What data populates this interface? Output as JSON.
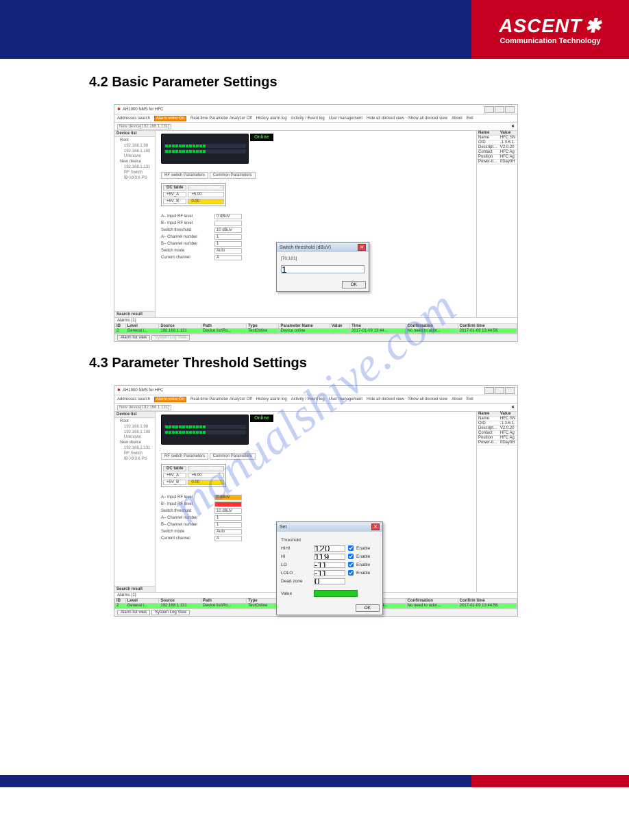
{
  "header": {
    "brand": "ASCENT",
    "brand_sub": "Communication Technology",
    "star": "✱"
  },
  "watermark": "manualshive.com",
  "sections": {
    "s1": {
      "num": "4.2",
      "title": "Basic Parameter Settings"
    },
    "s2": {
      "num": "4.3",
      "title": "Parameter Threshold Settings"
    }
  },
  "app": {
    "window_title": "AH1000 NMS for HFC",
    "toolbar": {
      "addresses_search": "Addresses search",
      "alarm_voice": "Alarm voice On",
      "analyzer": "Real-time Parameter Analyzer Off",
      "history": "History alarm log",
      "activity": "Activity / Event log",
      "user_mgmt": "User management",
      "hide_docked": "Hide all docked view",
      "show_docked": "Show all docked view",
      "about": "About",
      "exit": "Exit"
    },
    "sub_title_label": "New device[192.168.1.131]",
    "close_x": "✕",
    "device_list_title": "Device list",
    "tree": {
      "root": "Root",
      "node1": "192.168.1.98",
      "node2": "192.168.1.100",
      "node3": "Unknown",
      "node4": "New device",
      "node5": "192.168.1.131",
      "node6": "RF Switch",
      "node7": "IB-XXXX-PS"
    },
    "search_result": "Search result",
    "online": "Online",
    "tabs": {
      "rf": "RF switch Parameters",
      "common": "Common Parameters"
    },
    "dc": {
      "col1": "DC table",
      "col2": "Output voltage",
      "r1c1": "+5V_A",
      "r1c2": "+5.00",
      "r2c1": "+5V_B",
      "r2c2": "0.00"
    },
    "params": {
      "p1": "A– Input RF level",
      "p2": "B– Input RF level",
      "p3": "Switch threshold",
      "p4": "A– Channel number",
      "p5": "B– Channel number",
      "p6": "Switch mode",
      "p7": "Current channel",
      "v1": "0 dBuV",
      "v2": "",
      "v3": "10 dBuV",
      "v4": "1",
      "v5": "1",
      "v6": "Auto",
      "v7": "A"
    },
    "right": {
      "name_h": "Name",
      "value_h": "Value",
      "r1n": "Name",
      "r1v": "HFC SN",
      "r2n": "OID",
      "r2v": ".1.3.6.1.",
      "r3n": "Descript...",
      "r3v": "V2.0.20",
      "r4n": "Contact",
      "r4v": "HFC Ag",
      "r5n": "Position",
      "r5v": "HFC Ag",
      "r6n": "Power-ti...",
      "r6v": "0Day0H"
    },
    "alarms": {
      "title": "Alarms (1)",
      "cols": {
        "id": "ID",
        "level": "Level",
        "source": "Source",
        "path": "Path",
        "type": "Type",
        "pname": "Parameter Name",
        "value": "Value",
        "time": "Time",
        "conf": "Confirmation",
        "ctime": "Confirm time"
      },
      "row": {
        "id": "2",
        "level": "General i...",
        "source": "192.168.1.131",
        "path": "Device list\\Ro...",
        "type": "TestOnline",
        "pname": "Device online",
        "value": "",
        "time": "2017-01-09 13:44...",
        "conf": "No need to ackn...",
        "ctime": "2017-01-09 13:44:56"
      }
    },
    "viewtabs": {
      "alarmlist": "Alarm list view",
      "syslog": "System Log View"
    }
  },
  "popup1": {
    "title": "Switch threshold (dBuV)",
    "range": "[70,101]",
    "value": "1",
    "ok": "OK"
  },
  "popup2": {
    "title": "Set",
    "threshold_label": "Threshold",
    "rows": [
      {
        "lbl": "HIHI",
        "val": "120",
        "en": "Enable"
      },
      {
        "lbl": "HI",
        "val": "119",
        "en": "Enable"
      },
      {
        "lbl": "LO",
        "val": "-11",
        "en": "Enable"
      },
      {
        "lbl": "LOLO",
        "val": "-11",
        "en": "Enable"
      }
    ],
    "deadzone_lbl": "Dead zone",
    "deadzone_val": "0",
    "value_lbl": "Value",
    "ok": "OK"
  }
}
